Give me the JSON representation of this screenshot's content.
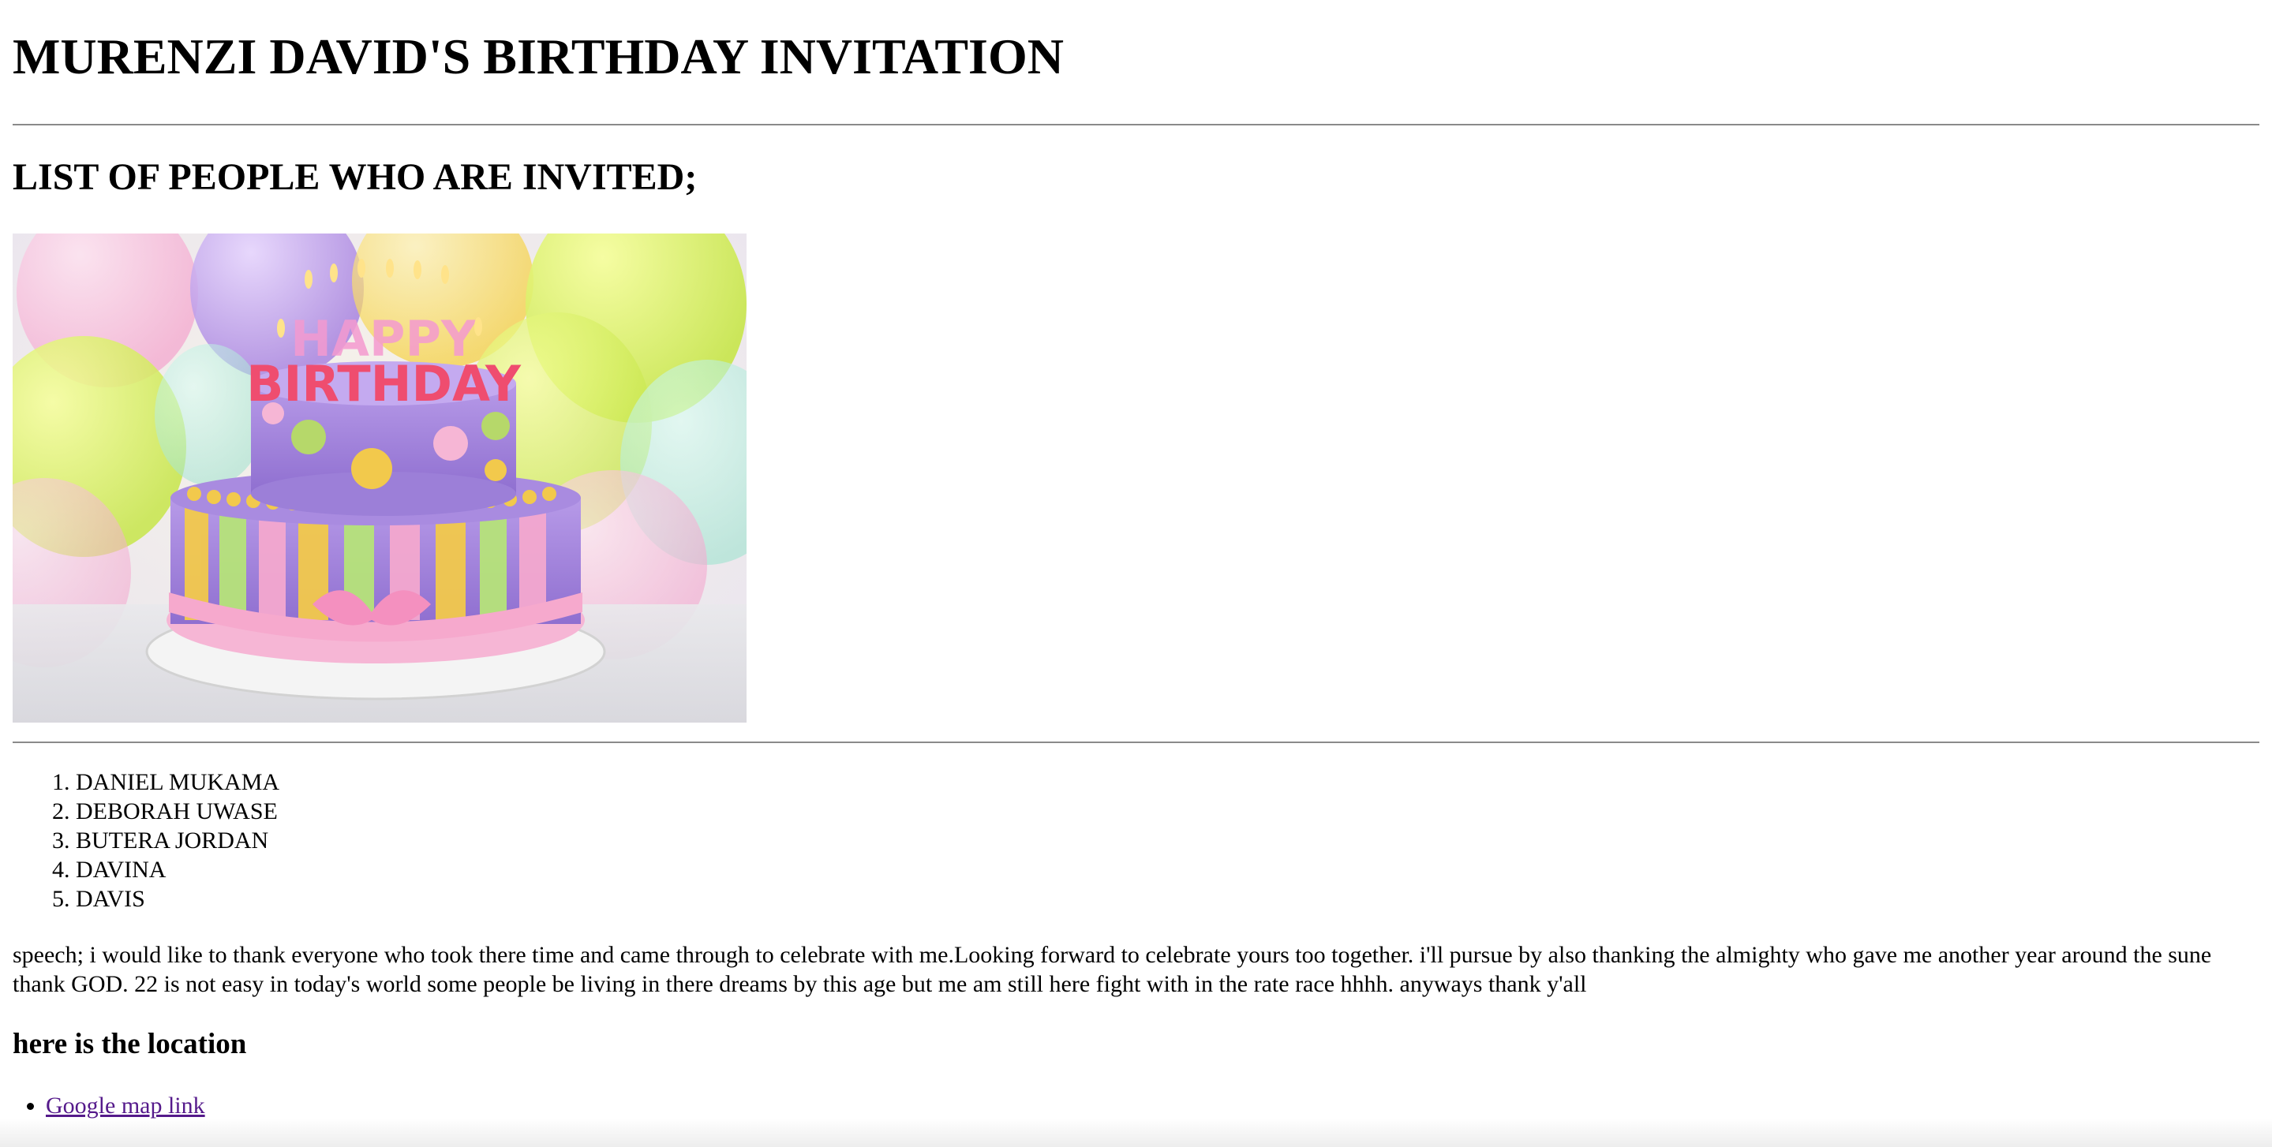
{
  "page": {
    "title": "MURENZI DAVID'S BIRTHDAY INVITATION",
    "subtitle": "LIST OF PEOPLE WHO ARE INVITED;",
    "image": {
      "alt": "Birthday cake",
      "cake_text_top": "HAPPY",
      "cake_text_bottom": "BIRTHDAY"
    },
    "guests": [
      "DANIEL MUKAMA",
      "DEBORAH UWASE",
      "BUTERA JORDAN",
      "DAVINA",
      "DAVIS"
    ],
    "speech": "speech; i would like to thank everyone who took there time and came through to celebrate with me.Looking forward to celebrate yours too together. i'll pursue by also thanking the almighty who gave me another year around the sune thank GOD. 22 is not easy in today's world some people be living in there dreams by this age but me am still here fight with in the rate race hhhh. anyways thank y'all",
    "location_heading": "here is the location",
    "links": [
      {
        "label": "Google map link"
      }
    ]
  },
  "colors": {
    "text": "#000000",
    "visited_link": "#551a8b",
    "rule": "#8a8a8a"
  }
}
